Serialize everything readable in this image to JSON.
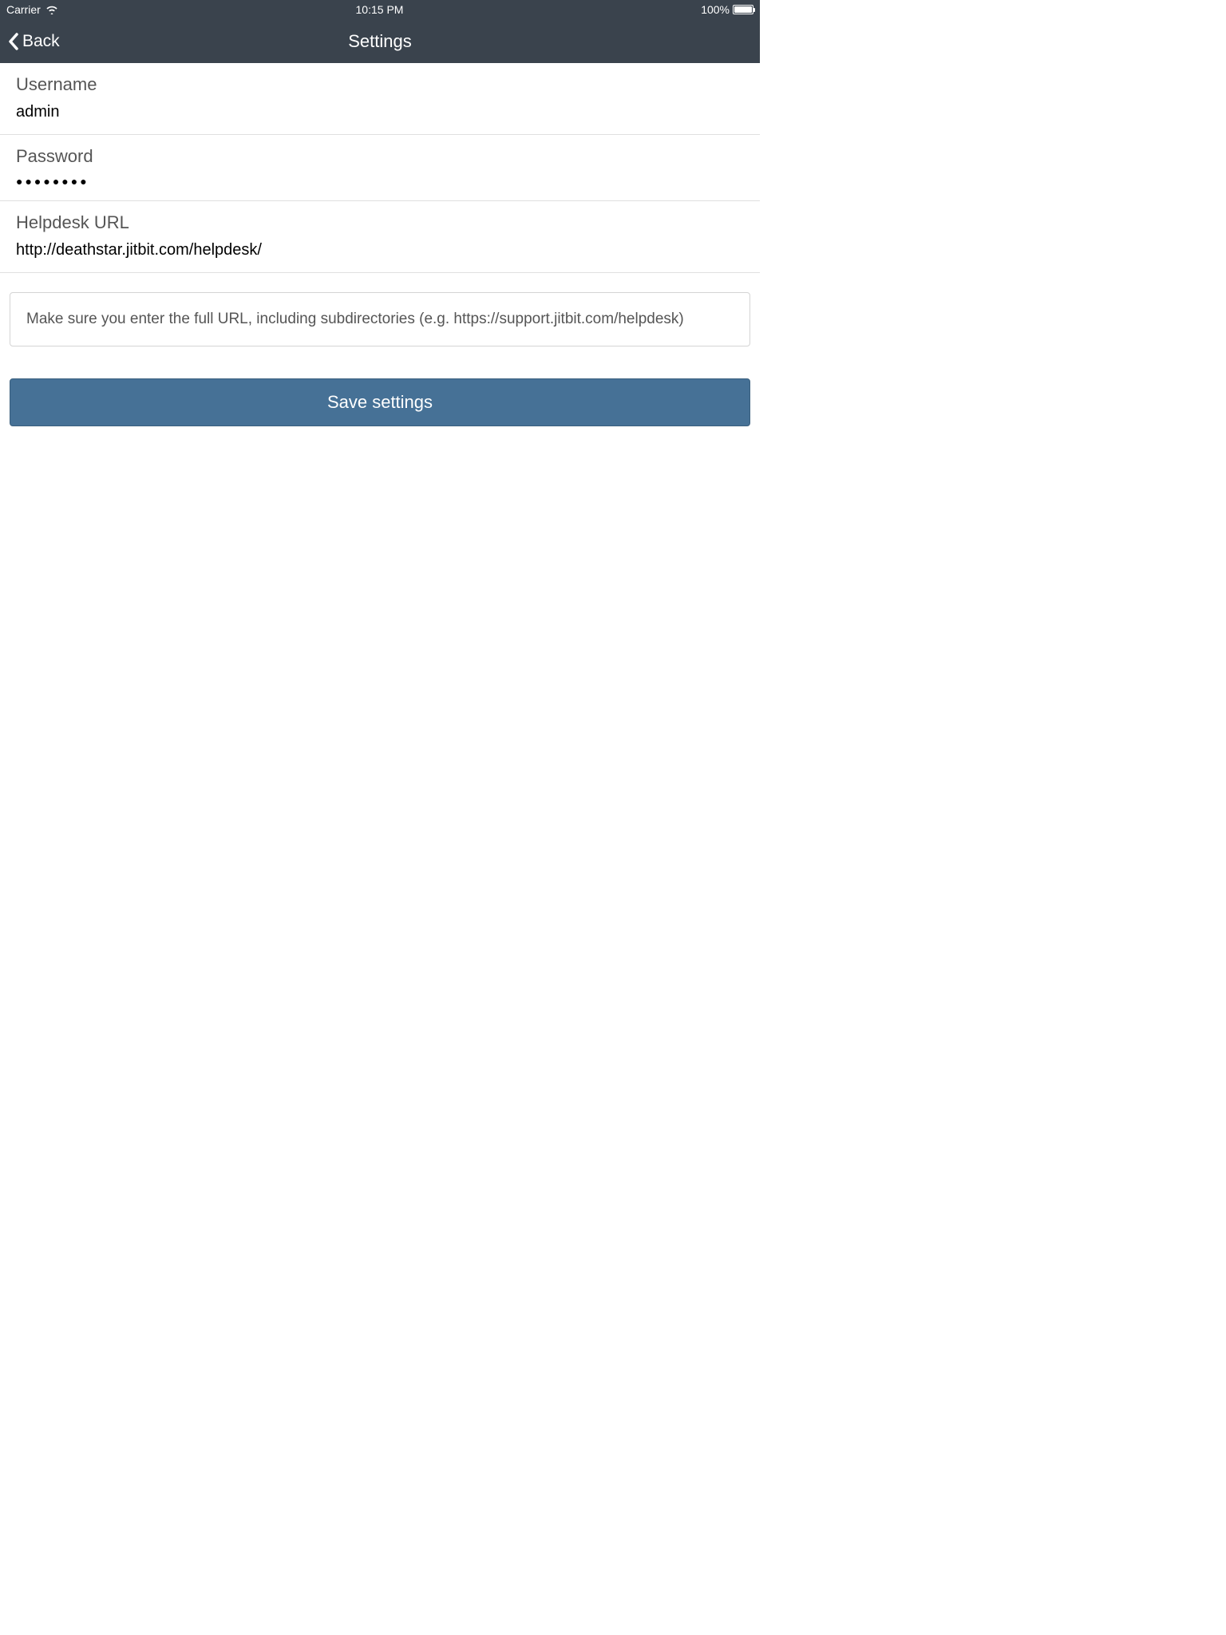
{
  "statusBar": {
    "carrier": "Carrier",
    "time": "10:15 PM",
    "batteryPercent": "100%"
  },
  "navBar": {
    "backLabel": "Back",
    "title": "Settings"
  },
  "form": {
    "username": {
      "label": "Username",
      "value": "admin"
    },
    "password": {
      "label": "Password",
      "value": "●●●●●●●●"
    },
    "url": {
      "label": "Helpdesk URL",
      "value": "http://deathstar.jitbit.com/helpdesk/"
    }
  },
  "infoBox": {
    "text": "Make sure you enter the full URL, including subdirectories (e.g. https://support.jitbit.com/helpdesk)"
  },
  "buttons": {
    "save": "Save settings"
  }
}
